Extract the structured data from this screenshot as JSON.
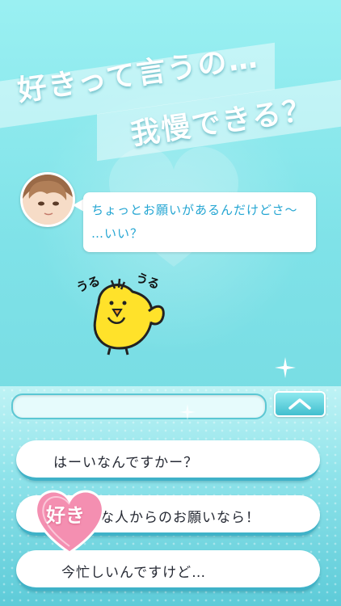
{
  "headline": {
    "line1": "好きって言うの…",
    "line2": "我慢できる？"
  },
  "dialogue": {
    "line1": "ちょっとお願いがあるんだけどさ〜",
    "line2": "…いい？"
  },
  "sound_effect": {
    "left": "うる",
    "right": "うる"
  },
  "input": {
    "value": ""
  },
  "choices": [
    {
      "label": "はーいなんですかー？"
    },
    {
      "label": "な人からのお願いなら！"
    },
    {
      "label": "今忙しいんですけど…"
    }
  ],
  "badge": {
    "text": "好き"
  },
  "colors": {
    "accent": "#23a5d2",
    "background": "#7fe3e8",
    "heart": "#f48fb1"
  },
  "icons": {
    "up": "chevron-up-icon",
    "sparkle": "sparkle-icon"
  }
}
